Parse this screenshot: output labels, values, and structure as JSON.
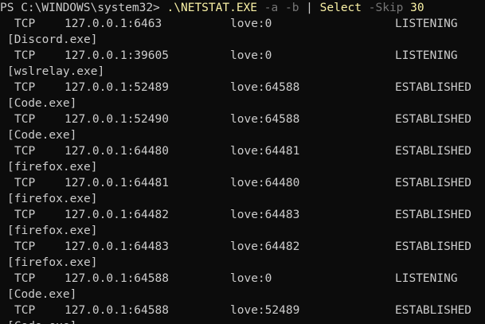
{
  "colors": {
    "background": "#0c0c0c",
    "foreground": "#cccccc",
    "command_yellow": "#f9f1a5",
    "parameter_gray": "#767676"
  },
  "command": {
    "prompt": "PS C:\\WINDOWS\\system32>",
    "exe": ".\\NETSTAT.EXE",
    "param_a": "-a",
    "param_b": "-b",
    "pipe": "|",
    "verb": "Select",
    "param_skip": "-Skip",
    "skip_value": "30"
  },
  "connections": [
    {
      "proto": "TCP",
      "local": "127.0.0.1:6463",
      "foreign": "love:0",
      "state": "LISTENING",
      "process": "[Discord.exe]"
    },
    {
      "proto": "TCP",
      "local": "127.0.0.1:39605",
      "foreign": "love:0",
      "state": "LISTENING",
      "process": "[wslrelay.exe]"
    },
    {
      "proto": "TCP",
      "local": "127.0.0.1:52489",
      "foreign": "love:64588",
      "state": "ESTABLISHED",
      "process": "[Code.exe]"
    },
    {
      "proto": "TCP",
      "local": "127.0.0.1:52490",
      "foreign": "love:64588",
      "state": "ESTABLISHED",
      "process": "[Code.exe]"
    },
    {
      "proto": "TCP",
      "local": "127.0.0.1:64480",
      "foreign": "love:64481",
      "state": "ESTABLISHED",
      "process": "[firefox.exe]"
    },
    {
      "proto": "TCP",
      "local": "127.0.0.1:64481",
      "foreign": "love:64480",
      "state": "ESTABLISHED",
      "process": "[firefox.exe]"
    },
    {
      "proto": "TCP",
      "local": "127.0.0.1:64482",
      "foreign": "love:64483",
      "state": "ESTABLISHED",
      "process": "[firefox.exe]"
    },
    {
      "proto": "TCP",
      "local": "127.0.0.1:64483",
      "foreign": "love:64482",
      "state": "ESTABLISHED",
      "process": "[firefox.exe]"
    },
    {
      "proto": "TCP",
      "local": "127.0.0.1:64588",
      "foreign": "love:0",
      "state": "LISTENING",
      "process": "[Code.exe]"
    },
    {
      "proto": "TCP",
      "local": "127.0.0.1:64588",
      "foreign": "love:52489",
      "state": "ESTABLISHED",
      "process": "[Code.exe]"
    }
  ]
}
